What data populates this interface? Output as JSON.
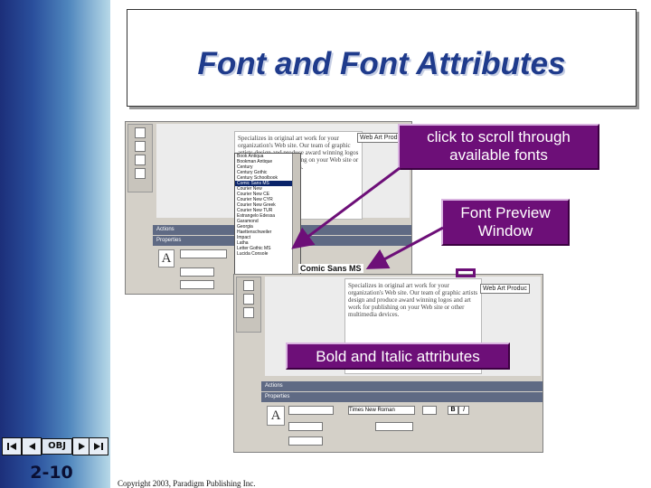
{
  "title": "Font and Font Attributes",
  "sidebar": {
    "obj_label": "OBJ",
    "page_number": "2-10",
    "nav_first_icon": "skip-back-icon",
    "nav_prev_icon": "back-icon",
    "nav_next_icon": "forward-icon",
    "nav_last_icon": "skip-forward-icon"
  },
  "callouts": {
    "scroll_fonts": "click to scroll through available fonts",
    "font_preview": "Font Preview Window",
    "bold_italic": "Bold and Italic attributes"
  },
  "screenshot_top": {
    "tag": "Web Art Produ",
    "font_list": [
      "Book Antiqua",
      "Bookman Antique",
      "Century",
      "Century Gothic",
      "Century Schoolbook",
      "Comic Sans MS",
      "Courier New",
      "Courier New CE",
      "Courier New CYR",
      "Courier New Greek",
      "Courier New TUR",
      "Estrangelo Edessa",
      "Garamond",
      "Georgia",
      "Haettenschweiler",
      "Impact",
      "Latha",
      "Letter Gothic MS",
      "Lucida Console"
    ],
    "selected_font": "Comic Sans MS",
    "panel_actions": "Actions",
    "panel_properties": "Properties",
    "preview_text": "Comic Sans MS",
    "paragraph": "Specializes in original art work for your organization's Web site. Our team of graphic artists design and produce award winning logos and art work for publishing on your Web site or other multimedia devices."
  },
  "screenshot_bottom": {
    "tag": "Web Art Produc",
    "panel_actions": "Actions",
    "panel_properties": "Properties",
    "font_field": "Times New Roman",
    "paragraph": "Specializes in original art work for your organization's Web site. Our team of graphic artists design and produce award winning logos and art work for publishing on your Web site or other multimedia devices."
  },
  "copyright": "Copyright 2003, Paradigm Publishing Inc.",
  "colors": {
    "callout": "#6d0f78",
    "title": "#1f3b8c",
    "sidebar_dark": "#1c2f7a"
  }
}
